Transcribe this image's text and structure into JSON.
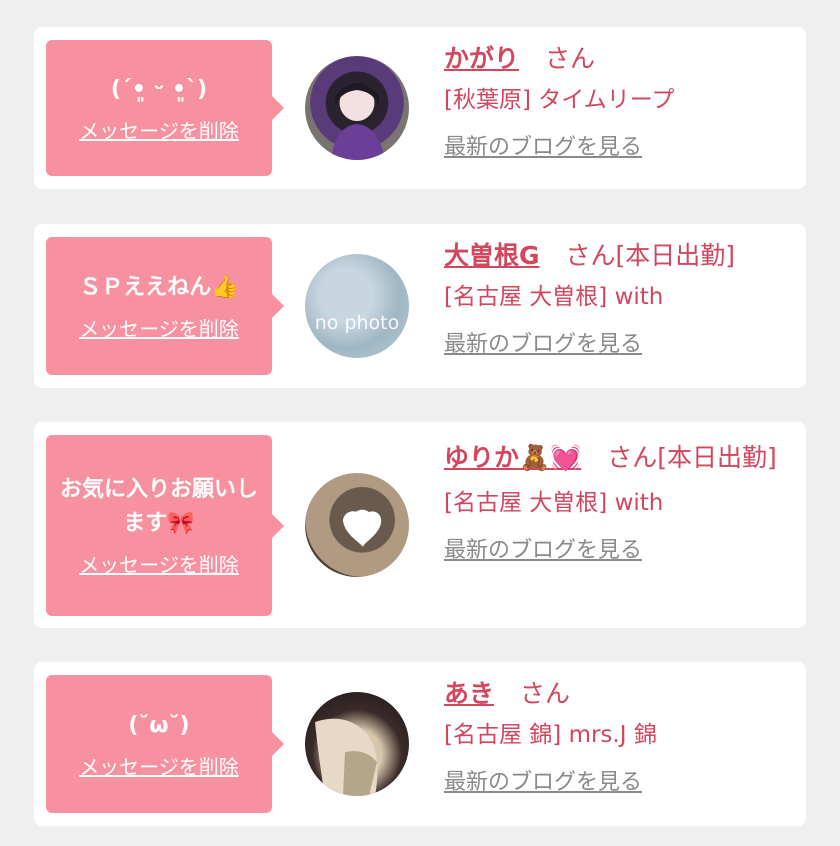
{
  "cards": [
    {
      "message": "(ˊ•͈ ᵕ •͈ˋ)",
      "delete_label": "メッセージを削除",
      "name": "かがり",
      "honorific": "さん",
      "status": "",
      "location": "[秋葉原] タイムリープ",
      "blog_label": "最新のブログを見る",
      "avatar_icon": "photo-avatar"
    },
    {
      "message": "ＳＰええねん👍",
      "delete_label": "メッセージを削除",
      "name": "大曽根G",
      "honorific": "さん",
      "status": "[本日出勤]",
      "location": "[名古屋 大曽根] with",
      "blog_label": "最新のブログを見る",
      "avatar_text": "no photo",
      "avatar_icon": "no-photo-avatar"
    },
    {
      "message": "お気に入りお願いします🎀",
      "delete_label": "メッセージを削除",
      "name": "ゆりか🧸💓",
      "honorific": "さん",
      "status": "[本日出勤]",
      "location": "[名古屋 大曽根] with",
      "blog_label": "最新のブログを見る",
      "avatar_icon": "photo-avatar"
    },
    {
      "message": "(˘ω˘)",
      "delete_label": "メッセージを削除",
      "name": "あき",
      "honorific": "さん",
      "status": "",
      "location": "[名古屋 錦] mrs.J 錦",
      "blog_label": "最新のブログを見る",
      "avatar_icon": "photo-avatar"
    }
  ],
  "colors": {
    "bubble": "#f8919f",
    "accent": "#d2465e",
    "muted": "#8a8a8a",
    "background": "#efefef"
  }
}
